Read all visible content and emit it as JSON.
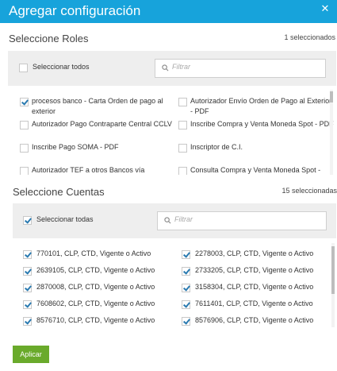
{
  "dialog": {
    "title": "Agregar configuración",
    "close_symbol": "✕",
    "header_color": "#17a3db"
  },
  "roles": {
    "title": "Seleccione Roles",
    "count": "1 seleccionados",
    "select_all_label": "Seleccionar todos",
    "select_all_checked": false,
    "filter_placeholder": "Filtrar",
    "items": [
      {
        "label": "procesos banco - Carta Orden de pago al exterior",
        "checked": true
      },
      {
        "label": "Autorizador Envío Orden de Pago al Exterior - PDF",
        "checked": false
      },
      {
        "label": "Autorizador Pago Contraparte Central CCLV",
        "checked": false
      },
      {
        "label": "Inscribe Compra y Venta Moneda Spot - PDF",
        "checked": false
      },
      {
        "label": "Inscribe Pago SOMA - PDF",
        "checked": false
      },
      {
        "label": "Inscriptor de C.I.",
        "checked": false
      },
      {
        "label": "Autorizador TEF a otros Bancos vía",
        "checked": false
      },
      {
        "label": "Consulta Compra y Venta Moneda Spot -",
        "checked": false
      }
    ]
  },
  "cuentas": {
    "title": "Seleccione Cuentas",
    "count": "15 seleccionadas",
    "select_all_label": "Seleccionar todas",
    "select_all_checked": true,
    "filter_placeholder": "Filtrar",
    "items": [
      {
        "label": "770101, CLP, CTD, Vigente o Activo",
        "checked": true
      },
      {
        "label": "2278003, CLP, CTD, Vigente o Activo",
        "checked": true
      },
      {
        "label": "2639105, CLP, CTD, Vigente o Activo",
        "checked": true
      },
      {
        "label": "2733205, CLP, CTD, Vigente o Activo",
        "checked": true
      },
      {
        "label": "2870008, CLP, CTD, Vigente o Activo",
        "checked": true
      },
      {
        "label": "3158304, CLP, CTD, Vigente o Activo",
        "checked": true
      },
      {
        "label": "7608602, CLP, CTD, Vigente o Activo",
        "checked": true
      },
      {
        "label": "7611401, CLP, CTD, Vigente o Activo",
        "checked": true
      },
      {
        "label": "8576710, CLP, CTD, Vigente o Activo",
        "checked": true
      },
      {
        "label": "8576906, CLP, CTD, Vigente o Activo",
        "checked": true
      }
    ]
  },
  "apply_button": {
    "label": "Aplicar",
    "color": "#6aaa2b"
  }
}
